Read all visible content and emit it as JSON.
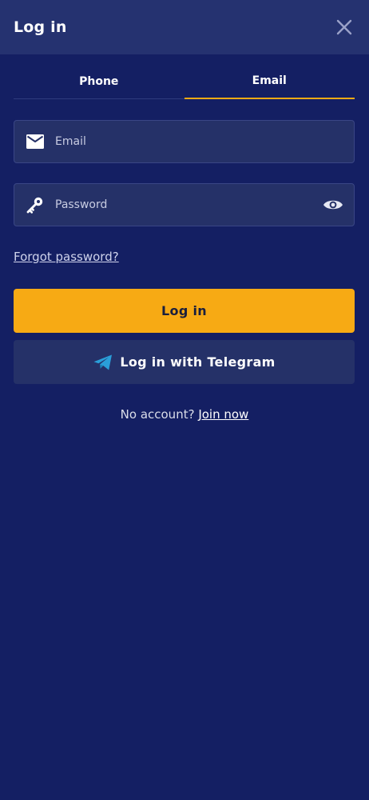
{
  "header": {
    "title": "Log in",
    "close_icon": "close-icon"
  },
  "tabs": [
    {
      "label": "Phone",
      "active": false
    },
    {
      "label": "Email",
      "active": true
    }
  ],
  "form": {
    "email": {
      "placeholder": "Email",
      "value": "",
      "icon": "envelope-icon"
    },
    "password": {
      "placeholder": "Password",
      "value": "",
      "icon": "key-icon",
      "toggle_icon": "eye-icon"
    },
    "forgot_label": "Forgot password?",
    "login_label": "Log in",
    "telegram_label": "Log in with Telegram",
    "telegram_icon": "telegram-icon"
  },
  "signup": {
    "prompt": "No account?",
    "link_label": "Join now"
  },
  "colors": {
    "background": "#141f63",
    "header": "#253270",
    "field": "#253168",
    "accent": "#f7aa14",
    "telegram_blue": "#2a9fd9"
  }
}
